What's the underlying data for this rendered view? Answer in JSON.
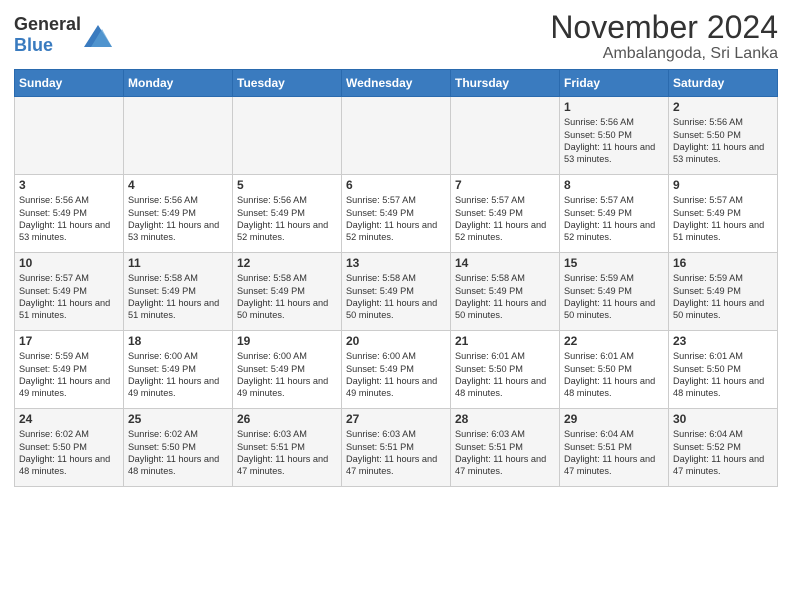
{
  "header": {
    "logo_general": "General",
    "logo_blue": "Blue",
    "title": "November 2024",
    "subtitle": "Ambalangoda, Sri Lanka"
  },
  "weekdays": [
    "Sunday",
    "Monday",
    "Tuesday",
    "Wednesday",
    "Thursday",
    "Friday",
    "Saturday"
  ],
  "weeks": [
    [
      {
        "day": "",
        "sunrise": "",
        "sunset": "",
        "daylight": ""
      },
      {
        "day": "",
        "sunrise": "",
        "sunset": "",
        "daylight": ""
      },
      {
        "day": "",
        "sunrise": "",
        "sunset": "",
        "daylight": ""
      },
      {
        "day": "",
        "sunrise": "",
        "sunset": "",
        "daylight": ""
      },
      {
        "day": "",
        "sunrise": "",
        "sunset": "",
        "daylight": ""
      },
      {
        "day": "1",
        "sunrise": "Sunrise: 5:56 AM",
        "sunset": "Sunset: 5:50 PM",
        "daylight": "Daylight: 11 hours and 53 minutes."
      },
      {
        "day": "2",
        "sunrise": "Sunrise: 5:56 AM",
        "sunset": "Sunset: 5:50 PM",
        "daylight": "Daylight: 11 hours and 53 minutes."
      }
    ],
    [
      {
        "day": "3",
        "sunrise": "Sunrise: 5:56 AM",
        "sunset": "Sunset: 5:49 PM",
        "daylight": "Daylight: 11 hours and 53 minutes."
      },
      {
        "day": "4",
        "sunrise": "Sunrise: 5:56 AM",
        "sunset": "Sunset: 5:49 PM",
        "daylight": "Daylight: 11 hours and 53 minutes."
      },
      {
        "day": "5",
        "sunrise": "Sunrise: 5:56 AM",
        "sunset": "Sunset: 5:49 PM",
        "daylight": "Daylight: 11 hours and 52 minutes."
      },
      {
        "day": "6",
        "sunrise": "Sunrise: 5:57 AM",
        "sunset": "Sunset: 5:49 PM",
        "daylight": "Daylight: 11 hours and 52 minutes."
      },
      {
        "day": "7",
        "sunrise": "Sunrise: 5:57 AM",
        "sunset": "Sunset: 5:49 PM",
        "daylight": "Daylight: 11 hours and 52 minutes."
      },
      {
        "day": "8",
        "sunrise": "Sunrise: 5:57 AM",
        "sunset": "Sunset: 5:49 PM",
        "daylight": "Daylight: 11 hours and 52 minutes."
      },
      {
        "day": "9",
        "sunrise": "Sunrise: 5:57 AM",
        "sunset": "Sunset: 5:49 PM",
        "daylight": "Daylight: 11 hours and 51 minutes."
      }
    ],
    [
      {
        "day": "10",
        "sunrise": "Sunrise: 5:57 AM",
        "sunset": "Sunset: 5:49 PM",
        "daylight": "Daylight: 11 hours and 51 minutes."
      },
      {
        "day": "11",
        "sunrise": "Sunrise: 5:58 AM",
        "sunset": "Sunset: 5:49 PM",
        "daylight": "Daylight: 11 hours and 51 minutes."
      },
      {
        "day": "12",
        "sunrise": "Sunrise: 5:58 AM",
        "sunset": "Sunset: 5:49 PM",
        "daylight": "Daylight: 11 hours and 50 minutes."
      },
      {
        "day": "13",
        "sunrise": "Sunrise: 5:58 AM",
        "sunset": "Sunset: 5:49 PM",
        "daylight": "Daylight: 11 hours and 50 minutes."
      },
      {
        "day": "14",
        "sunrise": "Sunrise: 5:58 AM",
        "sunset": "Sunset: 5:49 PM",
        "daylight": "Daylight: 11 hours and 50 minutes."
      },
      {
        "day": "15",
        "sunrise": "Sunrise: 5:59 AM",
        "sunset": "Sunset: 5:49 PM",
        "daylight": "Daylight: 11 hours and 50 minutes."
      },
      {
        "day": "16",
        "sunrise": "Sunrise: 5:59 AM",
        "sunset": "Sunset: 5:49 PM",
        "daylight": "Daylight: 11 hours and 50 minutes."
      }
    ],
    [
      {
        "day": "17",
        "sunrise": "Sunrise: 5:59 AM",
        "sunset": "Sunset: 5:49 PM",
        "daylight": "Daylight: 11 hours and 49 minutes."
      },
      {
        "day": "18",
        "sunrise": "Sunrise: 6:00 AM",
        "sunset": "Sunset: 5:49 PM",
        "daylight": "Daylight: 11 hours and 49 minutes."
      },
      {
        "day": "19",
        "sunrise": "Sunrise: 6:00 AM",
        "sunset": "Sunset: 5:49 PM",
        "daylight": "Daylight: 11 hours and 49 minutes."
      },
      {
        "day": "20",
        "sunrise": "Sunrise: 6:00 AM",
        "sunset": "Sunset: 5:49 PM",
        "daylight": "Daylight: 11 hours and 49 minutes."
      },
      {
        "day": "21",
        "sunrise": "Sunrise: 6:01 AM",
        "sunset": "Sunset: 5:50 PM",
        "daylight": "Daylight: 11 hours and 48 minutes."
      },
      {
        "day": "22",
        "sunrise": "Sunrise: 6:01 AM",
        "sunset": "Sunset: 5:50 PM",
        "daylight": "Daylight: 11 hours and 48 minutes."
      },
      {
        "day": "23",
        "sunrise": "Sunrise: 6:01 AM",
        "sunset": "Sunset: 5:50 PM",
        "daylight": "Daylight: 11 hours and 48 minutes."
      }
    ],
    [
      {
        "day": "24",
        "sunrise": "Sunrise: 6:02 AM",
        "sunset": "Sunset: 5:50 PM",
        "daylight": "Daylight: 11 hours and 48 minutes."
      },
      {
        "day": "25",
        "sunrise": "Sunrise: 6:02 AM",
        "sunset": "Sunset: 5:50 PM",
        "daylight": "Daylight: 11 hours and 48 minutes."
      },
      {
        "day": "26",
        "sunrise": "Sunrise: 6:03 AM",
        "sunset": "Sunset: 5:51 PM",
        "daylight": "Daylight: 11 hours and 47 minutes."
      },
      {
        "day": "27",
        "sunrise": "Sunrise: 6:03 AM",
        "sunset": "Sunset: 5:51 PM",
        "daylight": "Daylight: 11 hours and 47 minutes."
      },
      {
        "day": "28",
        "sunrise": "Sunrise: 6:03 AM",
        "sunset": "Sunset: 5:51 PM",
        "daylight": "Daylight: 11 hours and 47 minutes."
      },
      {
        "day": "29",
        "sunrise": "Sunrise: 6:04 AM",
        "sunset": "Sunset: 5:51 PM",
        "daylight": "Daylight: 11 hours and 47 minutes."
      },
      {
        "day": "30",
        "sunrise": "Sunrise: 6:04 AM",
        "sunset": "Sunset: 5:52 PM",
        "daylight": "Daylight: 11 hours and 47 minutes."
      }
    ]
  ]
}
